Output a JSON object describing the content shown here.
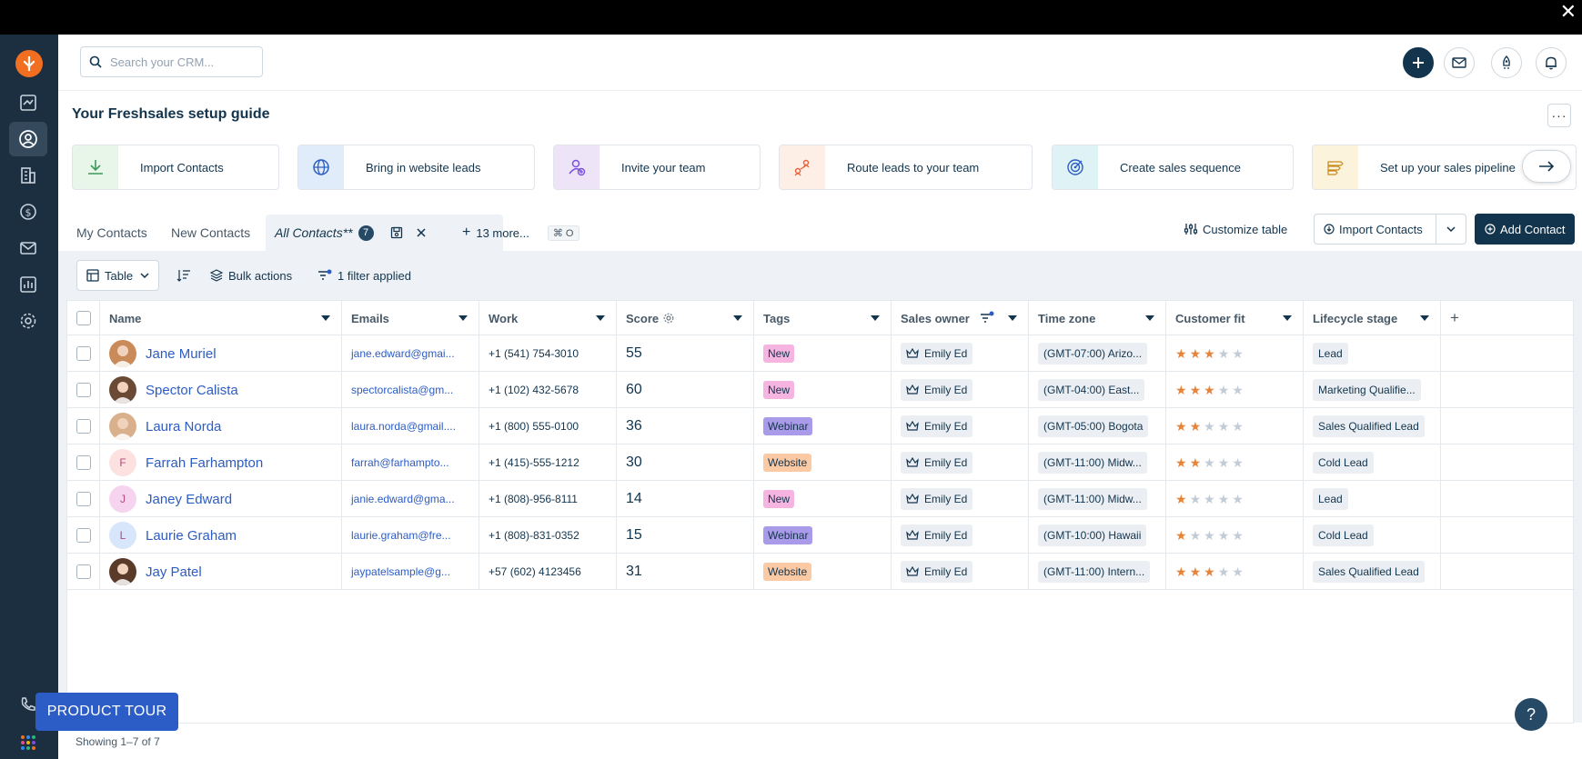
{
  "search": {
    "placeholder": "Search your CRM..."
  },
  "guide": {
    "title": "Your Freshsales setup guide",
    "more_label": "···",
    "cards": [
      {
        "label": "Import Contacts",
        "icon": "download-icon",
        "color": "#e8f5e9"
      },
      {
        "label": "Bring in website leads",
        "icon": "globe-icon",
        "color": "#e1ecfb"
      },
      {
        "label": "Invite your team",
        "icon": "add-user-icon",
        "color": "#ede4f7"
      },
      {
        "label": "Route leads to your team",
        "icon": "route-icon",
        "color": "#fdeee6"
      },
      {
        "label": "Create sales sequence",
        "icon": "target-icon",
        "color": "#dff3f7"
      },
      {
        "label": "Set up your sales pipeline",
        "icon": "pipeline-icon",
        "color": "#fbf3dc"
      }
    ]
  },
  "tabs": {
    "my_contacts": "My Contacts",
    "new_contacts": "New Contacts",
    "all_contacts": "All Contacts**",
    "all_contacts_count": "7",
    "more": "13 more...",
    "shortcut": "⌘ O"
  },
  "actions": {
    "customize": "Customize table",
    "import": "Import Contacts",
    "add": "Add Contact"
  },
  "toolbar": {
    "view": "Table",
    "bulk": "Bulk actions",
    "filter": "1 filter applied"
  },
  "columns": [
    "Name",
    "Emails",
    "Work",
    "Score",
    "Tags",
    "Sales owner",
    "Time zone",
    "Customer fit",
    "Lifecycle stage"
  ],
  "rows": [
    {
      "name": "Jane Muriel",
      "avatar": "photo",
      "initial": "",
      "email": "jane.edward@gmai...",
      "work": "+1 (541) 754-3010",
      "score": "55",
      "tag": "New",
      "owner": "Emily Ed",
      "tz": "(GMT-07:00) Arizo...",
      "fit": 3,
      "stage": "Lead"
    },
    {
      "name": "Spector Calista",
      "avatar": "photo",
      "initial": "",
      "email": "spectorcalista@gm...",
      "work": "+1 (102) 432-5678",
      "score": "60",
      "tag": "New",
      "owner": "Emily Ed",
      "tz": "(GMT-04:00) East...",
      "fit": 3,
      "stage": "Marketing Qualifie..."
    },
    {
      "name": "Laura Norda",
      "avatar": "photo",
      "initial": "",
      "email": "laura.norda@gmail....",
      "work": "+1 (800) 555-0100",
      "score": "36",
      "tag": "Webinar",
      "owner": "Emily Ed",
      "tz": "(GMT-05:00) Bogota",
      "fit": 2,
      "stage": "Sales Qualified Lead"
    },
    {
      "name": "Farrah Farhampton",
      "avatar": "initial",
      "initial": "F",
      "email": "farrah@farhampto...",
      "work": "+1 (415)-555-1212",
      "score": "30",
      "tag": "Website",
      "owner": "Emily Ed",
      "tz": "(GMT-11:00) Midw...",
      "fit": 2,
      "stage": "Cold Lead"
    },
    {
      "name": "Janey Edward",
      "avatar": "initial",
      "initial": "J",
      "email": "janie.edward@gma...",
      "work": "+1 (808)-956-8111",
      "score": "14",
      "tag": "New",
      "owner": "Emily Ed",
      "tz": "(GMT-11:00) Midw...",
      "fit": 1,
      "stage": "Lead"
    },
    {
      "name": "Laurie Graham",
      "avatar": "initial",
      "initial": "L",
      "email": "laurie.graham@fre...",
      "work": "+1 (808)-831-0352",
      "score": "15",
      "tag": "Webinar",
      "owner": "Emily Ed",
      "tz": "(GMT-10:00) Hawaii",
      "fit": 1,
      "stage": "Cold Lead"
    },
    {
      "name": "Jay Patel",
      "avatar": "photo",
      "initial": "",
      "email": "jaypatelsample@g...",
      "work": "+57 (602) 4123456",
      "score": "31",
      "tag": "Website",
      "owner": "Emily Ed",
      "tz": "(GMT-11:00) Intern...",
      "fit": 3,
      "stage": "Sales Qualified Lead"
    }
  ],
  "tag_colors": {
    "New": "#f5b5e0",
    "Webinar": "#a99be9",
    "Website": "#fbc9a4"
  },
  "initial_colors": {
    "F": "#fde1e1",
    "J": "#f6d4f0",
    "L": "#d7e6fb"
  },
  "footer": {
    "showing": "Showing 1–7 of 7"
  },
  "product_tour": "PRODUCT TOUR",
  "help": "?"
}
